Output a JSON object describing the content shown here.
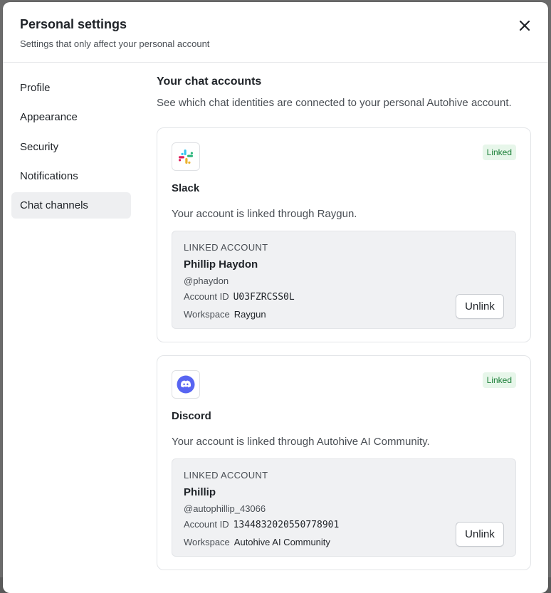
{
  "modal": {
    "title": "Personal settings",
    "subtitle": "Settings that only affect your personal account"
  },
  "nav": {
    "items": [
      {
        "label": "Profile"
      },
      {
        "label": "Appearance"
      },
      {
        "label": "Security"
      },
      {
        "label": "Notifications"
      },
      {
        "label": "Chat channels",
        "active": true
      }
    ]
  },
  "section": {
    "title": "Your chat accounts",
    "description": "See which chat identities are connected to your personal Autohive account."
  },
  "accounts": [
    {
      "provider": "Slack",
      "icon": "slack-logo-icon",
      "status": "Linked",
      "description": "Your account is linked through Raygun.",
      "linked_label": "LINKED ACCOUNT",
      "name": "Phillip Haydon",
      "handle": "@phaydon",
      "account_id_label": "Account ID",
      "account_id": "U03FZRCSS0L",
      "workspace_label": "Workspace",
      "workspace": "Raygun",
      "unlink_label": "Unlink"
    },
    {
      "provider": "Discord",
      "icon": "discord-logo-icon",
      "status": "Linked",
      "description": "Your account is linked through Autohive AI Community.",
      "linked_label": "LINKED ACCOUNT",
      "name": "Phillip",
      "handle": "@autophillip_43066",
      "account_id_label": "Account ID",
      "account_id": "1344832020550778901",
      "workspace_label": "Workspace",
      "workspace": "Autohive AI Community",
      "unlink_label": "Unlink"
    }
  ],
  "colors": {
    "badge_bg": "#e7f6ea",
    "badge_text": "#1a7f37",
    "active_nav_bg": "#eeeff1",
    "discord_blurple": "#5865F2"
  }
}
